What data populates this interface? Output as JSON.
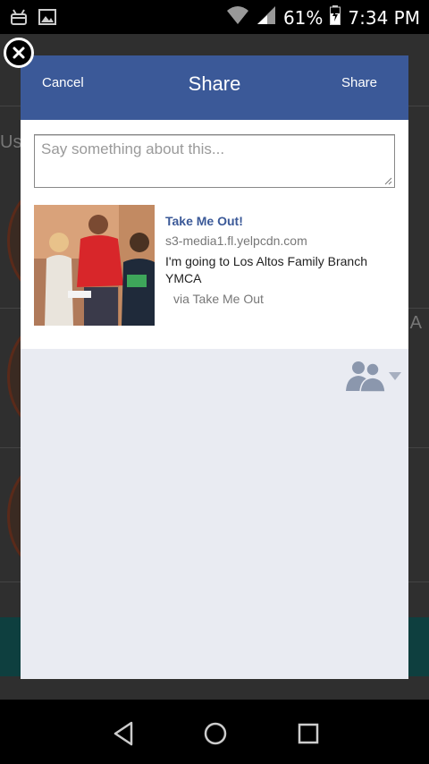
{
  "status_bar": {
    "battery_percent": "61%",
    "time": "7:34 PM",
    "icons": [
      "android-icon",
      "image-icon",
      "wifi-icon",
      "signal-icon",
      "battery-icon"
    ]
  },
  "background_app": {
    "partial_text": "Us",
    "partial_text_right": "A"
  },
  "dialog": {
    "header": {
      "cancel_label": "Cancel",
      "title": "Share",
      "share_label": "Share"
    },
    "comment": {
      "placeholder": "Say something about this..."
    },
    "attachment": {
      "title": "Take Me Out!",
      "domain": "s3-media1.fl.yelpcdn.com",
      "description": "I'm going to Los Altos Family Branch YMCA",
      "via": "via Take Me Out"
    },
    "audience_icon": "friends-icon"
  },
  "colors": {
    "header_blue": "#3b5998",
    "dialog_bg": "#e9ebf2"
  },
  "navbar": {
    "icons": [
      "back-icon",
      "home-icon",
      "recents-icon"
    ]
  }
}
